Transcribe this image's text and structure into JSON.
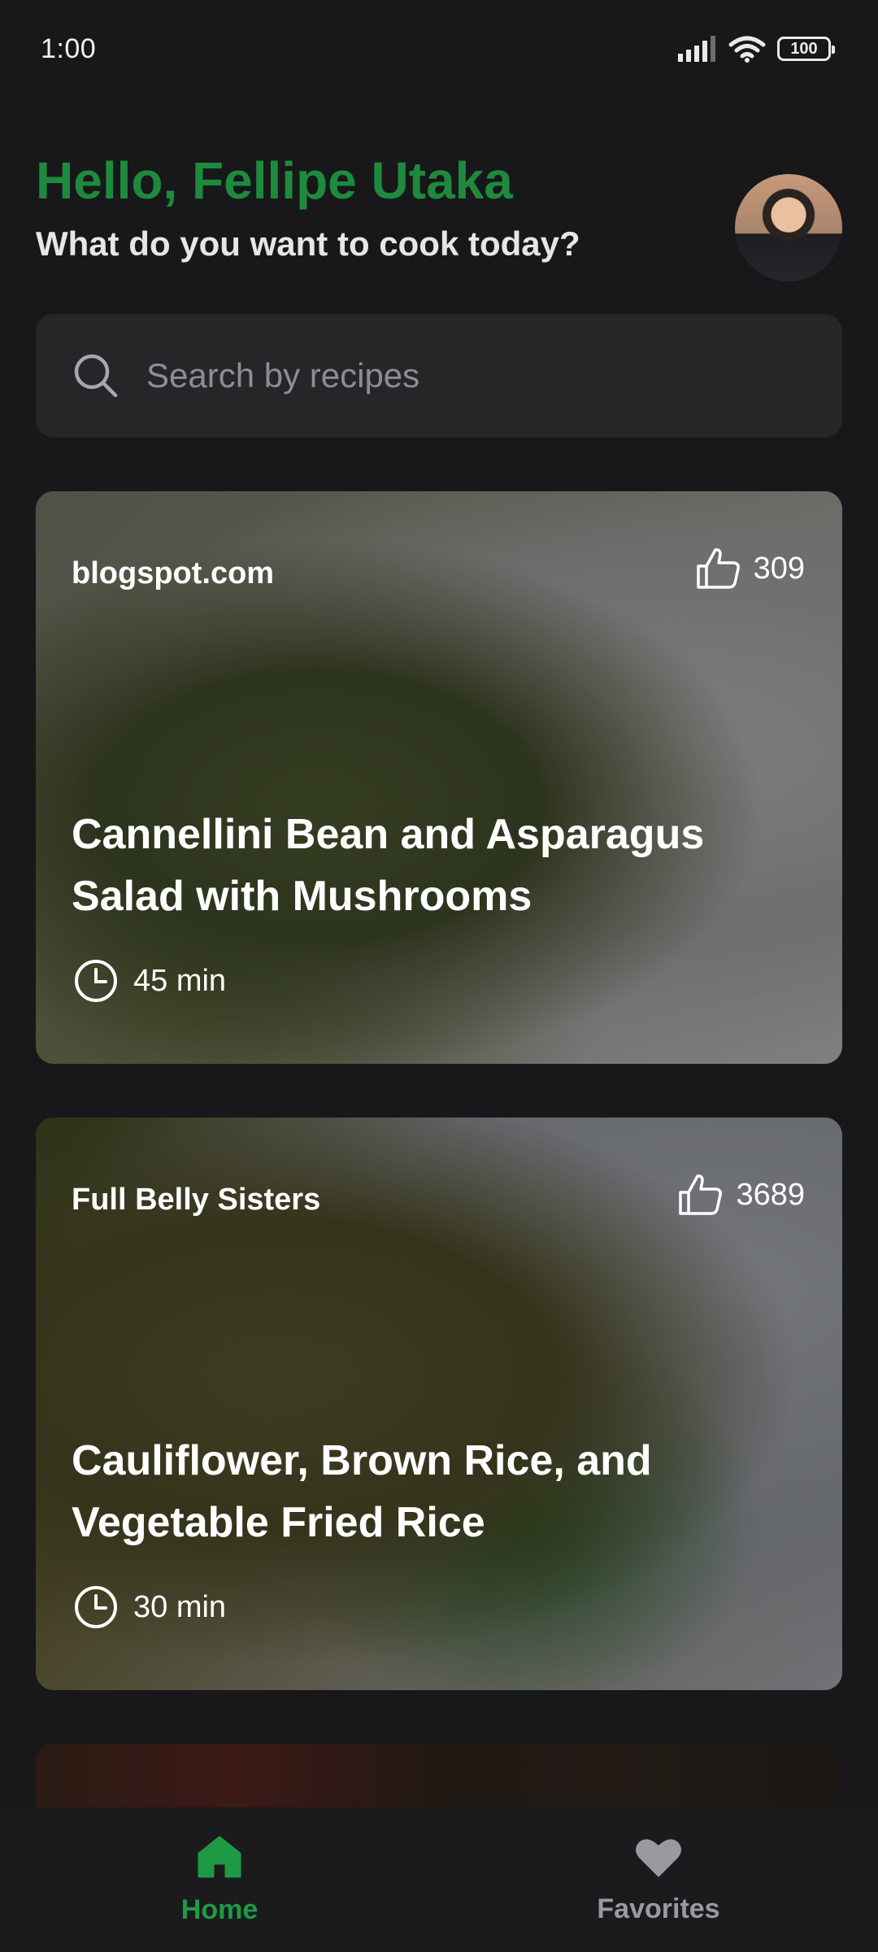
{
  "status_bar": {
    "time": "1:00",
    "battery": "100",
    "icons": [
      "signal-icon",
      "wifi-icon",
      "battery-icon"
    ]
  },
  "header": {
    "title": "Hello, Fellipe Utaka",
    "subtitle": "What do you want to cook today?"
  },
  "search": {
    "placeholder": "Search by recipes",
    "value": ""
  },
  "recipes": [
    {
      "source": "blogspot.com",
      "likes": "309",
      "title": "Cannellini Bean and Asparagus Salad with Mushrooms",
      "time": "45 min"
    },
    {
      "source": "Full Belly Sisters",
      "likes": "3689",
      "title": "Cauliflower, Brown Rice, and Vegetable Fried Rice",
      "time": "30 min"
    }
  ],
  "nav": {
    "home_label": "Home",
    "favorites_label": "Favorites",
    "active": "home"
  },
  "colors": {
    "accent": "#1e9a45",
    "background": "#18181a",
    "surface": "#262629",
    "inactive": "#9a9a9e"
  }
}
